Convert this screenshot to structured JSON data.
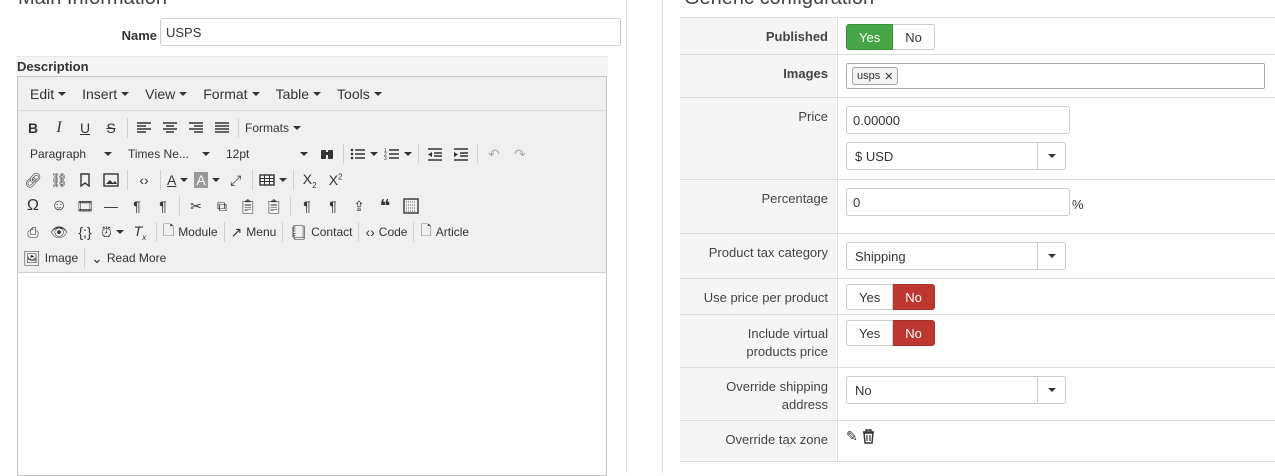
{
  "left": {
    "section_title": "Main Information",
    "name_label": "Name",
    "name_value": "USPS",
    "description_label": "Description",
    "menubar": [
      "Edit",
      "Insert",
      "View",
      "Format",
      "Table",
      "Tools"
    ],
    "toolbar": {
      "formats": "Formats",
      "paragraph": "Paragraph",
      "font_family": "Times Ne...",
      "font_size": "12pt",
      "module": "Module",
      "menu": "Menu",
      "contact": "Contact",
      "code": "Code",
      "article": "Article",
      "image": "Image",
      "read_more": "Read More"
    }
  },
  "right": {
    "section_title": "Generic configuration",
    "published": {
      "label": "Published",
      "yes": "Yes",
      "no": "No"
    },
    "images": {
      "label": "Images",
      "tag": "usps"
    },
    "price": {
      "label": "Price",
      "value": "0.00000",
      "currency": "$ USD"
    },
    "percentage": {
      "label": "Percentage",
      "value": "0",
      "unit": "%"
    },
    "tax_category": {
      "label": "Product tax category",
      "value": "Shipping"
    },
    "price_per_product": {
      "label": "Use price per product",
      "yes": "Yes",
      "no": "No"
    },
    "include_virtual": {
      "label_1": "Include virtual",
      "label_2": "products price",
      "yes": "Yes",
      "no": "No"
    },
    "override_shipping": {
      "label_1": "Override shipping",
      "label_2": "address",
      "value": "No"
    },
    "override_tax": {
      "label": "Override tax zone"
    }
  },
  "colors": {
    "yes_active": "#46a546",
    "no_active": "#bd362f"
  }
}
